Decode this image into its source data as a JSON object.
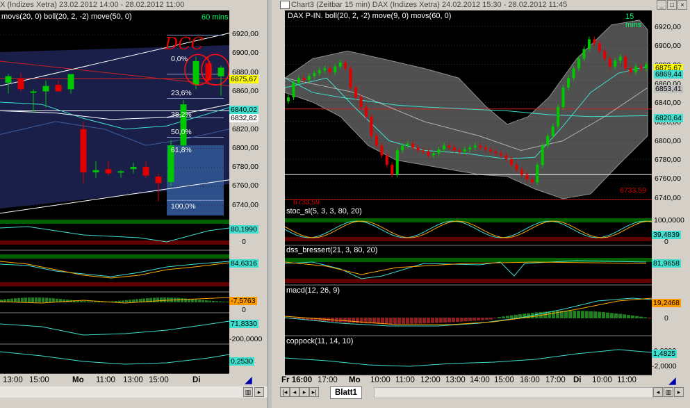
{
  "left": {
    "title": "X (Indizes Xetra) 23.02.2012 14:00 - 28.02.2012 11:00",
    "indicator_label": "movs(20, 0) boll(20, 2, -2) move(50, 0)",
    "timeframe": "60 mins",
    "price_axis": [
      "6920,00",
      "6900,00",
      "6880,00",
      "6860,00",
      "6840,00",
      "6820,00",
      "6800,00",
      "6780,00",
      "6760,00",
      "6740,00"
    ],
    "price_tags": {
      "last": "6875,67",
      "ma1": "6840,02",
      "ma2": "6832,82"
    },
    "annotation": "DCC",
    "fib_levels": [
      "0,0%",
      "23,6%",
      "38,2%",
      "50,0%",
      "61,8%",
      "100,0%"
    ],
    "sub_values": [
      "80,1990",
      "0",
      "84,6316",
      "-7,5763",
      "0",
      "71,8330",
      "-200,0000",
      "0,2530"
    ],
    "time_axis": [
      "13:00",
      "15:00",
      "Mo",
      "11:00",
      "13:00",
      "15:00",
      "Di"
    ],
    "chart_data": {
      "type": "candlestick",
      "ylim": [
        6735,
        6925
      ],
      "candles": [
        {
          "o": 6858,
          "h": 6866,
          "l": 6848,
          "c": 6864
        },
        {
          "o": 6862,
          "h": 6867,
          "l": 6850,
          "c": 6852
        },
        {
          "o": 6850,
          "h": 6852,
          "l": 6830,
          "c": 6850
        },
        {
          "o": 6850,
          "h": 6860,
          "l": 6835,
          "c": 6855
        },
        {
          "o": 6856,
          "h": 6860,
          "l": 6850,
          "c": 6850
        },
        {
          "o": 6852,
          "h": 6866,
          "l": 6848,
          "c": 6866
        },
        {
          "o": 6815,
          "h": 6822,
          "l": 6765,
          "c": 6775
        },
        {
          "o": 6775,
          "h": 6785,
          "l": 6770,
          "c": 6777
        },
        {
          "o": 6778,
          "h": 6785,
          "l": 6772,
          "c": 6774
        },
        {
          "o": 6775,
          "h": 6777,
          "l": 6770,
          "c": 6776
        },
        {
          "o": 6778,
          "h": 6784,
          "l": 6774,
          "c": 6780
        },
        {
          "o": 6780,
          "h": 6785,
          "l": 6770,
          "c": 6772
        },
        {
          "o": 6771,
          "h": 6774,
          "l": 6748,
          "c": 6765
        },
        {
          "o": 6766,
          "h": 6805,
          "l": 6762,
          "c": 6800
        },
        {
          "o": 6800,
          "h": 6842,
          "l": 6796,
          "c": 6838
        },
        {
          "o": 6856,
          "h": 6882,
          "l": 6852,
          "c": 6878
        },
        {
          "o": 6876,
          "h": 6882,
          "l": 6856,
          "c": 6860
        },
        {
          "o": 6864,
          "h": 6874,
          "l": 6846,
          "c": 6872
        }
      ]
    }
  },
  "right": {
    "title": "Chart3 (Zeitbar 15 min)  DAX (Indizes Xetra) 24.02.2012 15:30 - 28.02.2012 11:45",
    "indicator_label": "DAX P-IN. boll(20, 2, -2) move(9, 0) movs(60, 0)",
    "timeframe": "15 mins",
    "price_axis": [
      "6920,00",
      "6900,00",
      "6880,00",
      "6860,00",
      "6840,00",
      "6820,00",
      "6800,00",
      "6780,00",
      "6760,00",
      "6740,00"
    ],
    "price_tags": {
      "a": "6875,67",
      "b": "6869,44",
      "c": "6853,41",
      "d": "6820,64"
    },
    "level_labels": {
      "low_left": "6733,59",
      "low_right": "6733,59"
    },
    "sub_panels": [
      {
        "label": "stoc_sl(5, 3, 3, 80, 20)",
        "values": [
          "100,0000",
          "39,4839",
          "0"
        ]
      },
      {
        "label": "dss_bressert(21, 3, 80, 20)",
        "values": [
          "81,9658"
        ]
      },
      {
        "label": "macd(12, 26, 9)",
        "values": [
          "19,2468",
          "0"
        ]
      },
      {
        "label": "coppock(11, 14, 10)",
        "values": [
          "0,0000",
          "1,4825",
          "-2,0000"
        ]
      }
    ],
    "time_axis": [
      "Fr 16:00",
      "17:00",
      "Mo",
      "10:00",
      "11:00",
      "12:00",
      "13:00",
      "14:00",
      "15:00",
      "16:00",
      "17:00",
      "Di",
      "10:00",
      "11:00"
    ],
    "sheet_tab": "Blatt1"
  },
  "colors": {
    "up": "#00c800",
    "down": "#e00000",
    "band": "#808080",
    "ma": "#40e0d0"
  }
}
